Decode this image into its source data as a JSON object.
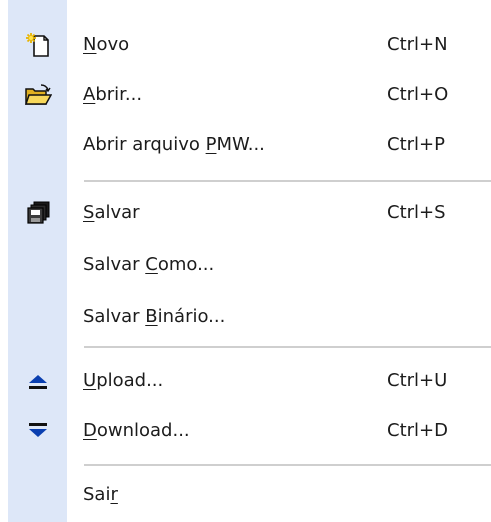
{
  "menu": {
    "items": [
      {
        "id": "novo",
        "label": "Novo",
        "mnemonic_index": 0,
        "shortcut": "Ctrl+N",
        "icon": "new-file-icon"
      },
      {
        "id": "abrir",
        "label": "Abrir...",
        "mnemonic_index": 0,
        "shortcut": "Ctrl+O",
        "icon": "open-folder-icon"
      },
      {
        "id": "abrir-pmw",
        "label": "Abrir arquivo PMW...",
        "mnemonic_index": 14,
        "shortcut": "Ctrl+P",
        "icon": ""
      },
      {
        "id": "salvar",
        "label": "Salvar",
        "mnemonic_index": 0,
        "shortcut": "Ctrl+S",
        "icon": "save-icon"
      },
      {
        "id": "salvar-como",
        "label": "Salvar Como...",
        "mnemonic_index": 7,
        "shortcut": "",
        "icon": ""
      },
      {
        "id": "salvar-binario",
        "label": "Salvar Binário...",
        "mnemonic_index": 7,
        "shortcut": "",
        "icon": ""
      },
      {
        "id": "upload",
        "label": "Upload...",
        "mnemonic_index": 0,
        "shortcut": "Ctrl+U",
        "icon": "upload-icon"
      },
      {
        "id": "download",
        "label": "Download...",
        "mnemonic_index": 0,
        "shortcut": "Ctrl+D",
        "icon": "download-icon"
      },
      {
        "id": "sair",
        "label": "Sair",
        "mnemonic_index": 3,
        "shortcut": "",
        "icon": ""
      }
    ]
  },
  "colors": {
    "gutter": "#dde7f8",
    "text": "#1c1c1c",
    "separator": "#cfcfcf",
    "accent": "#0a246a"
  }
}
